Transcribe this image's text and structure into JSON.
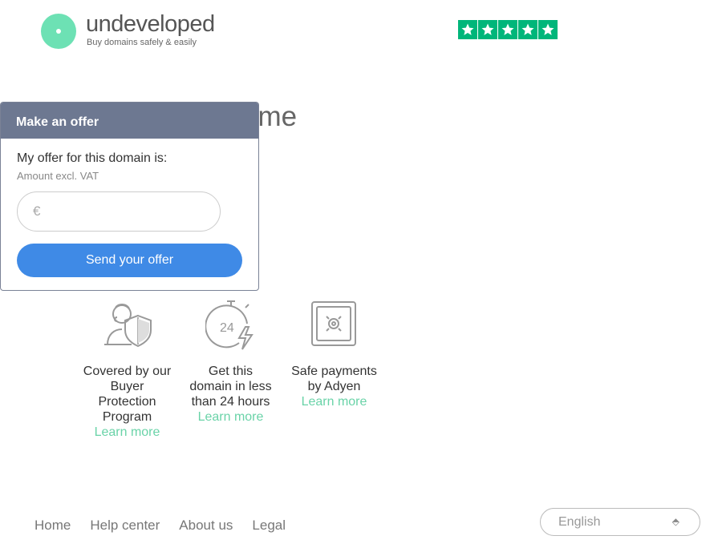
{
  "header": {
    "logo_word": "undeveloped",
    "logo_tagline": "Buy domains safely & easily",
    "rating_stars": 5
  },
  "main": {
    "heading_visible": "ame"
  },
  "offer": {
    "title": "Make an offer",
    "label": "My offer for this domain is:",
    "sublabel": "Amount excl. VAT",
    "currency": "€",
    "amount_value": "",
    "submit_label": "Send your offer"
  },
  "features": [
    {
      "text": "Covered by our Buyer Protection Program",
      "link": "Learn more",
      "icon": "buyer-protection-icon"
    },
    {
      "text": "Get this domain in less than 24 hours",
      "link": "Learn more",
      "icon": "stopwatch-24-icon"
    },
    {
      "text": "Safe payments by Adyen",
      "link": "Learn more",
      "icon": "safe-icon"
    }
  ],
  "footer": {
    "links": [
      "Home",
      "Help center",
      "About us",
      "Legal"
    ],
    "language": "English"
  },
  "colors": {
    "brand_green": "#6de1b4",
    "trustpilot_green": "#00b67a",
    "button_blue": "#3f8ae6",
    "panel_header": "#6d7891",
    "link_green": "#6ad3a8"
  }
}
